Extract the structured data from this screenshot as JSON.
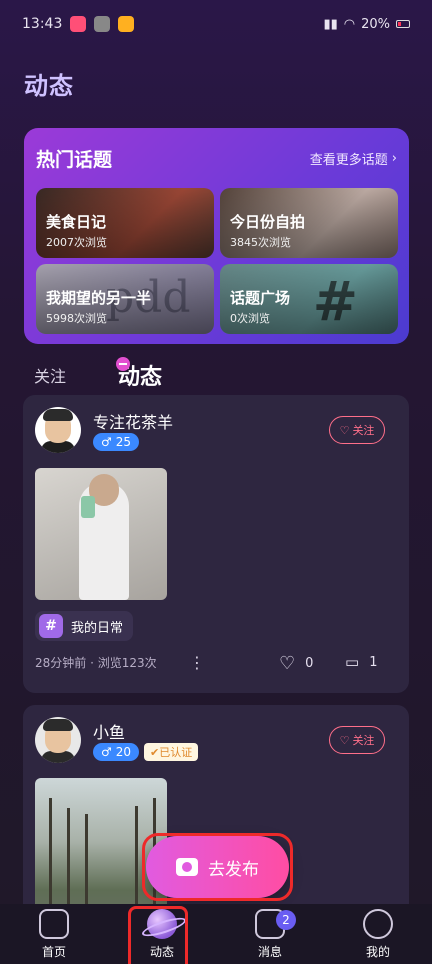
{
  "status": {
    "time": "13:43",
    "battery": "20%"
  },
  "page_title": "动态",
  "hot": {
    "title": "热门话题",
    "more": "查看更多话题",
    "topics": [
      {
        "name": "美食日记",
        "views": "2007次浏览"
      },
      {
        "name": "今日份自拍",
        "views": "3845次浏览"
      },
      {
        "name": "我期望的另一半",
        "views": "5998次浏览"
      },
      {
        "name": "话题广场",
        "views": "0次浏览"
      }
    ]
  },
  "tabs": {
    "follow": "关注",
    "dynamic": "动态"
  },
  "posts": [
    {
      "username": "专注花茶羊",
      "gender_age": "25",
      "follow": "关注",
      "topic": "我的日常",
      "meta": "28分钟前 · 浏览123次",
      "likes": "0",
      "comments": "1"
    },
    {
      "username": "小鱼",
      "gender_age": "20",
      "verified": "已认证",
      "follow": "关注"
    }
  ],
  "publish_label": "去发布",
  "nav": {
    "home": "首页",
    "dynamic": "动态",
    "messages": "消息",
    "messages_badge": "2",
    "mine": "我的"
  },
  "icons": [
    "heart-plus-icon",
    "hash-icon",
    "more-vert-icon",
    "heart-icon",
    "comment-icon",
    "camera-icon",
    "home-icon",
    "planet-icon",
    "message-icon",
    "smile-icon"
  ]
}
